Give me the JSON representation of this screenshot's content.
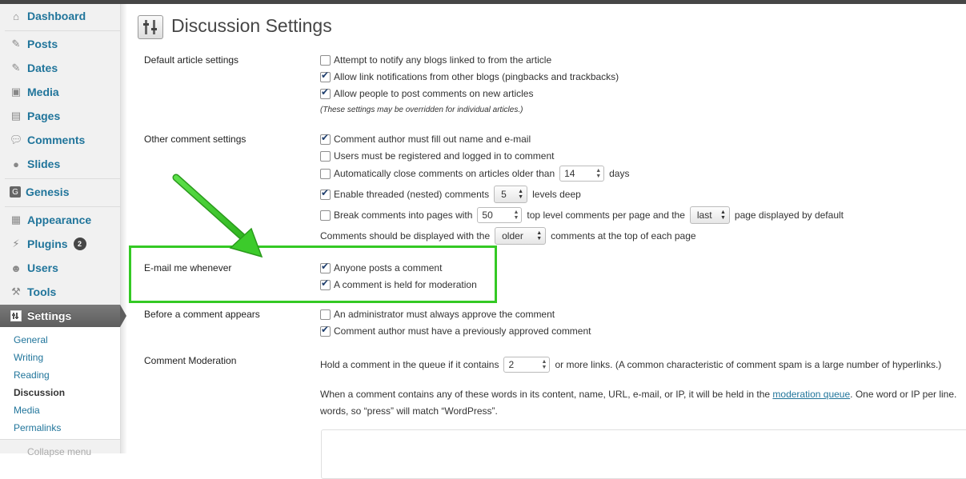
{
  "sidebar": {
    "items": [
      {
        "label": "Dashboard",
        "icon": "home-icon"
      },
      {
        "label": "Posts",
        "icon": "pin-icon"
      },
      {
        "label": "Dates",
        "icon": "pin-icon"
      },
      {
        "label": "Media",
        "icon": "media-icon"
      },
      {
        "label": "Pages",
        "icon": "pages-icon"
      },
      {
        "label": "Comments",
        "icon": "comment-icon"
      },
      {
        "label": "Slides",
        "icon": "circle-icon"
      },
      {
        "label": "Genesis",
        "icon": "genesis-g-icon"
      },
      {
        "label": "Appearance",
        "icon": "appearance-icon"
      },
      {
        "label": "Plugins",
        "icon": "plug-icon",
        "badge": "2"
      },
      {
        "label": "Users",
        "icon": "users-icon"
      },
      {
        "label": "Tools",
        "icon": "tools-icon"
      }
    ],
    "settings": {
      "label": "Settings",
      "icon": "settings-icon"
    },
    "submenu": [
      "General",
      "Writing",
      "Reading",
      "Discussion",
      "Media",
      "Permalinks"
    ],
    "current_submenu": "Discussion",
    "collapse_label": "Collapse menu"
  },
  "page": {
    "title": "Discussion Settings",
    "icon": "settings-page-icon"
  },
  "sections": {
    "default_article": {
      "label": "Default article settings",
      "options": [
        {
          "label": "Attempt to notify any blogs linked to from the article",
          "checked": false
        },
        {
          "label": "Allow link notifications from other blogs (pingbacks and trackbacks)",
          "checked": true
        },
        {
          "label": "Allow people to post comments on new articles",
          "checked": true
        }
      ],
      "note": "(These settings may be overridden for individual articles.)"
    },
    "other_comment": {
      "label": "Other comment settings",
      "opt1": "Comment author must fill out name and e-mail",
      "opt2": "Users must be registered and logged in to comment",
      "opt3_pre": "Automatically close comments on articles older than",
      "opt3_value": "14",
      "opt3_post": "days",
      "opt4_pre": "Enable threaded (nested) comments",
      "opt4_value": "5",
      "opt4_post": "levels deep",
      "opt5_pre": "Break comments into pages with",
      "opt5_value": "50",
      "opt5_mid": "top level comments per page and the",
      "opt5_select": "last",
      "opt5_post": "page displayed by default",
      "opt6_pre": "Comments should be displayed with the",
      "opt6_select": "older",
      "opt6_post": "comments at the top of each page",
      "checked": [
        true,
        false,
        false,
        true,
        false
      ]
    },
    "email": {
      "label": "E-mail me whenever",
      "options": [
        {
          "label": "Anyone posts a comment",
          "checked": true
        },
        {
          "label": "A comment is held for moderation",
          "checked": true
        }
      ]
    },
    "before_comment": {
      "label": "Before a comment appears",
      "options": [
        {
          "label": "An administrator must always approve the comment",
          "checked": false
        },
        {
          "label": "Comment author must have a previously approved comment",
          "checked": true
        }
      ]
    },
    "moderation": {
      "label": "Comment Moderation",
      "hold_pre": "Hold a comment in the queue if it contains",
      "hold_value": "2",
      "hold_post": "or more links. (A common characteristic of comment spam is a large number of hyperlinks.)",
      "words_pre": "When a comment contains any of these words in its content, name, URL, e-mail, or IP, it will be held in the",
      "words_link": "moderation queue",
      "words_post": ". One word or IP per line.",
      "words_line2": "words, so “press” will match “WordPress”."
    }
  },
  "colors": {
    "highlight": "#34c924",
    "link": "#21759b",
    "sidebar_active": "#5e5e5e"
  }
}
